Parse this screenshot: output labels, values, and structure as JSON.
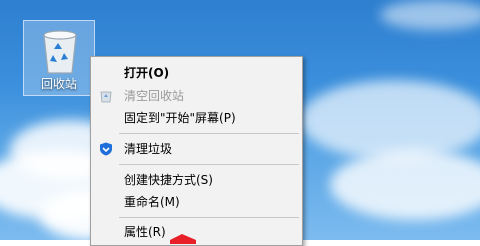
{
  "desktop": {
    "recycle_bin_label": "回收站"
  },
  "context_menu": {
    "items": {
      "open": "打开(O)",
      "empty": "清空回收站",
      "pin_start": "固定到\"开始\"屏幕(P)",
      "clean": "清理垃圾",
      "create_shortcut": "创建快捷方式(S)",
      "rename": "重命名(M)",
      "properties": "属性(R)"
    }
  },
  "colors": {
    "highlight_arrow": "#e8202a",
    "shield_icon": "#1e6fd9"
  }
}
